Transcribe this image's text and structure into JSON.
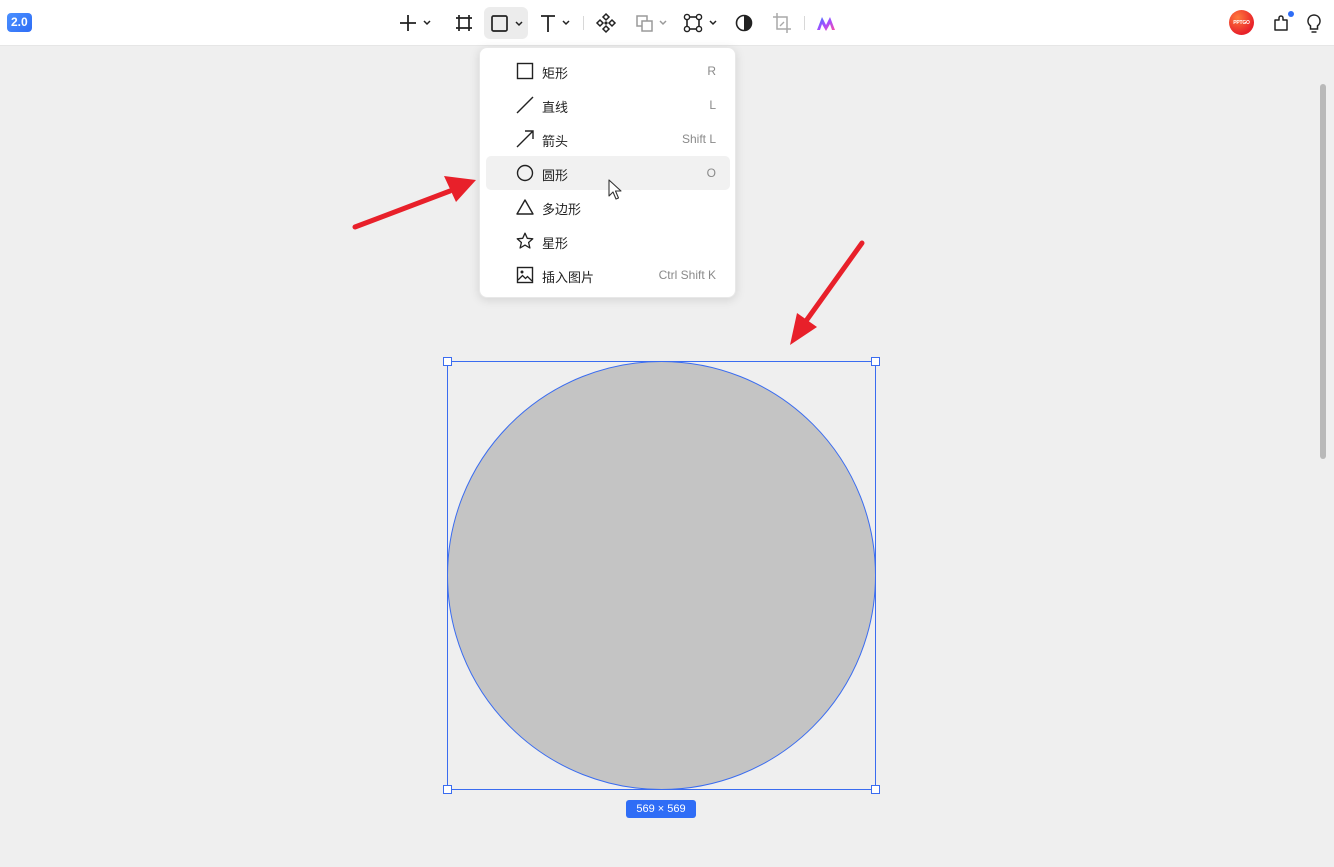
{
  "app": {
    "version_badge": "2.0",
    "avatar_text": "PPTGO"
  },
  "toolbar": {
    "icons": [
      "plus-icon",
      "frame-icon",
      "rectangle-icon",
      "text-icon",
      "component-icon",
      "boolean-icon",
      "path-icon",
      "mask-icon",
      "crop-icon",
      "ai-logo-icon"
    ],
    "right_icons": [
      "avatar",
      "plugin-icon",
      "lightbulb-icon"
    ]
  },
  "shape_menu": {
    "items": [
      {
        "label": "矩形",
        "shortcut": "R",
        "icon": "rectangle-icon"
      },
      {
        "label": "直线",
        "shortcut": "L",
        "icon": "line-icon"
      },
      {
        "label": "箭头",
        "shortcut": "Shift L",
        "icon": "arrow-icon"
      },
      {
        "label": "圆形",
        "shortcut": "O",
        "icon": "circle-icon",
        "hovered": true
      },
      {
        "label": "多边形",
        "shortcut": "",
        "icon": "triangle-icon"
      },
      {
        "label": "星形",
        "shortcut": "",
        "icon": "star-icon"
      },
      {
        "label": "插入图片",
        "shortcut": "Ctrl Shift K",
        "icon": "image-icon"
      }
    ]
  },
  "canvas": {
    "shape_fill": "#c4c4c4",
    "selection_color": "#3a6cf0",
    "size_label": "569 × 569"
  },
  "colors": {
    "accent": "#2f6df6",
    "annotation_arrow": "#e8202a"
  }
}
